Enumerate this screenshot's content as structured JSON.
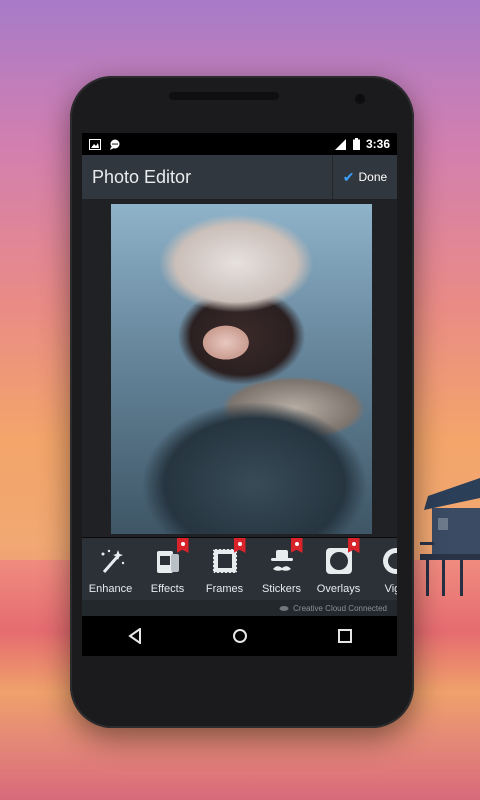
{
  "status_bar": {
    "time": "3:36",
    "icons": [
      "image-icon",
      "chat-icon",
      "signal-icon",
      "battery-icon"
    ]
  },
  "app_bar": {
    "title": "Photo Editor",
    "done_label": "Done"
  },
  "tools": [
    {
      "label": "Enhance",
      "icon": "magic-wand-icon",
      "badge": false
    },
    {
      "label": "Effects",
      "icon": "effects-icon",
      "badge": true
    },
    {
      "label": "Frames",
      "icon": "frames-icon",
      "badge": true
    },
    {
      "label": "Stickers",
      "icon": "stickers-icon",
      "badge": true
    },
    {
      "label": "Overlays",
      "icon": "overlays-icon",
      "badge": true
    },
    {
      "label": "Vign",
      "icon": "vignette-icon",
      "badge": false
    }
  ],
  "footer_text": "Creative Cloud Connected",
  "colors": {
    "accent": "#3aa0ff",
    "badge": "#d8232a",
    "appbar": "#31373e",
    "toolbar": "#2c3137"
  }
}
